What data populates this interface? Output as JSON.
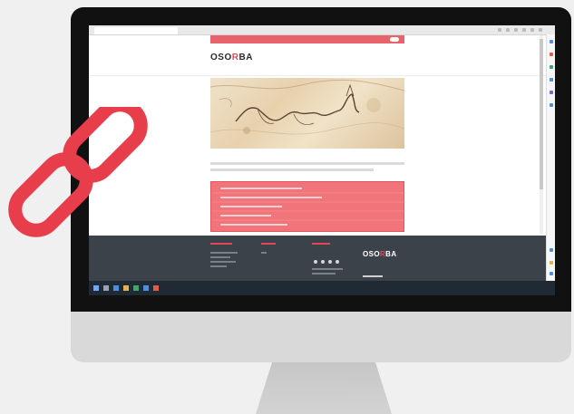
{
  "browser": {
    "tab_title": "",
    "clock": ""
  },
  "site": {
    "topbar_text": "",
    "logo_main": "OSO",
    "logo_accent": "R",
    "logo_tail": "BA",
    "nav": [
      "",
      "",
      "",
      "",
      ""
    ]
  },
  "article": {
    "caption": "",
    "links": [
      "",
      "",
      "",
      "",
      ""
    ]
  },
  "footer": {
    "headings": [
      "",
      "",
      ""
    ],
    "logo_main": "OSO",
    "logo_accent": "R",
    "logo_tail": "BA"
  },
  "colors": {
    "accent": "#e04a55",
    "link_box": "#f07479",
    "footer_bg": "#3c424a",
    "chain_icon": "#e83d4b"
  },
  "icons": {
    "chain": "chain-link-icon"
  }
}
